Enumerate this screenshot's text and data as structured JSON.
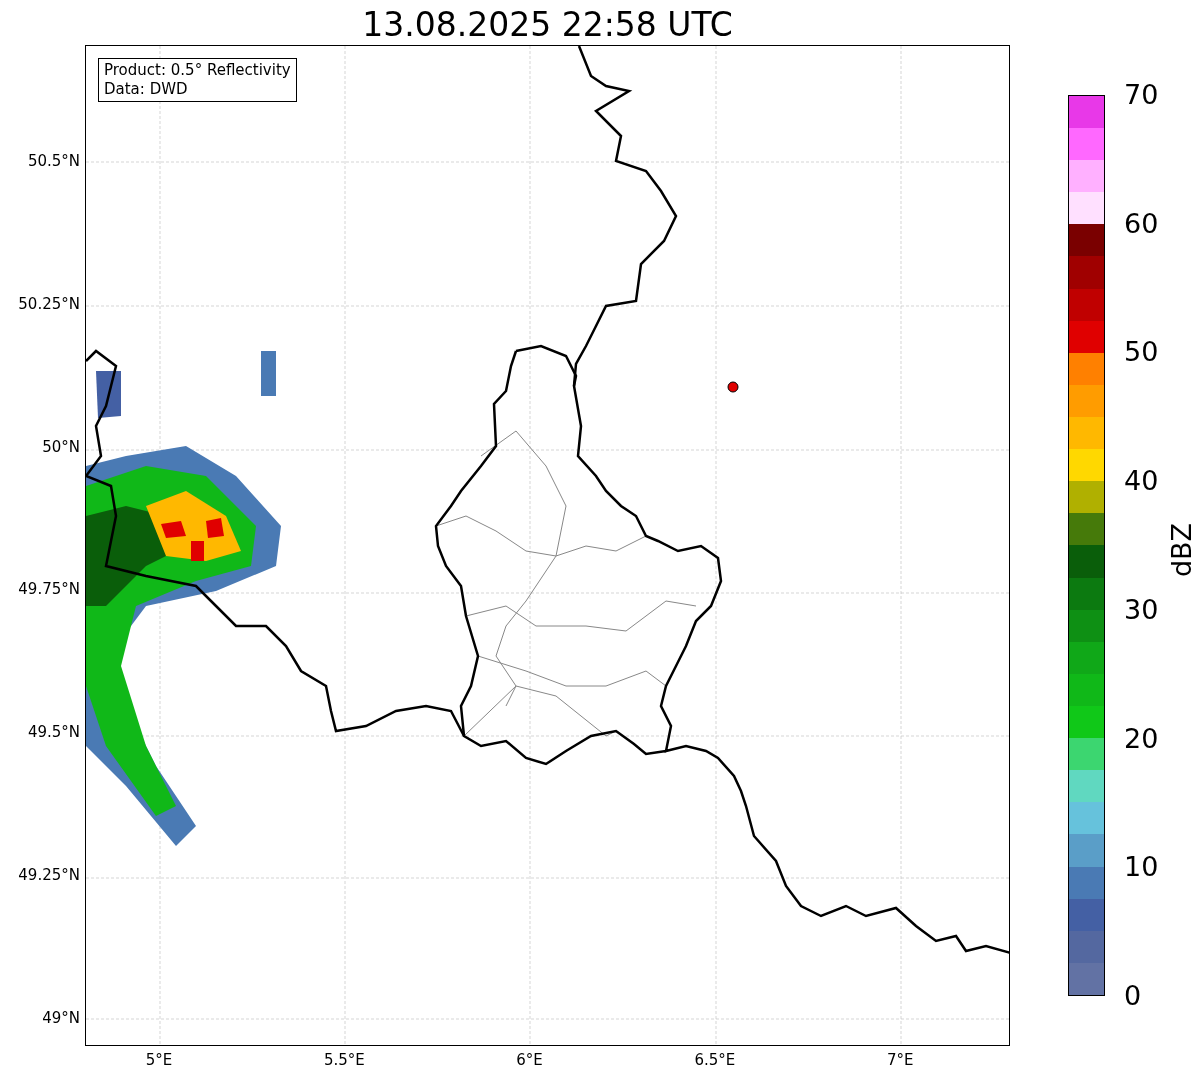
{
  "title": "13.08.2025 22:58 UTC",
  "legend": {
    "lines": [
      "Product: 0.5° Reflectivity",
      "Data: DWD"
    ]
  },
  "map": {
    "lat_ticks": [
      "50.5°N",
      "50.25°N",
      "50°N",
      "49.75°N",
      "49.5°N",
      "49.25°N",
      "49°N"
    ],
    "lon_ticks": [
      "5°E",
      "5.5°E",
      "6°E",
      "6.5°E",
      "7°E"
    ]
  },
  "colorbar": {
    "label": "dBZ",
    "ticks": [
      "70",
      "60",
      "50",
      "40",
      "30",
      "20",
      "10",
      "0"
    ],
    "bins": [
      {
        "color": "#6272a4"
      },
      {
        "color": "#5468a0"
      },
      {
        "color": "#4460a4"
      },
      {
        "color": "#4a7ab4"
      },
      {
        "color": "#5a9ec8"
      },
      {
        "color": "#66c2dc"
      },
      {
        "color": "#60d8c0"
      },
      {
        "color": "#3cd670"
      },
      {
        "color": "#10c818"
      },
      {
        "color": "#10b818"
      },
      {
        "color": "#10a818"
      },
      {
        "color": "#0e9014"
      },
      {
        "color": "#0c7a10"
      },
      {
        "color": "#0a5e0a"
      },
      {
        "color": "#467a0a"
      },
      {
        "color": "#b0b000"
      },
      {
        "color": "#ffd800"
      },
      {
        "color": "#ffb800"
      },
      {
        "color": "#ff9c00"
      },
      {
        "color": "#ff8000"
      },
      {
        "color": "#e00000"
      },
      {
        "color": "#c00000"
      },
      {
        "color": "#a00000"
      },
      {
        "color": "#7a0000"
      },
      {
        "color": "#ffe0ff"
      },
      {
        "color": "#ffb0ff"
      },
      {
        "color": "#ff68ff"
      },
      {
        "color": "#e838e8"
      }
    ]
  }
}
